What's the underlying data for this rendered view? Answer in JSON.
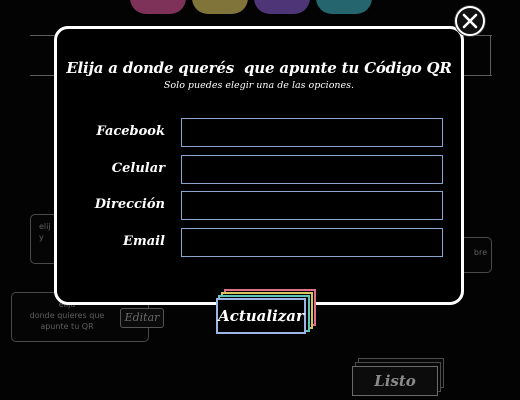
{
  "modal": {
    "title": "Elija a donde querés  que apunte tu Código QR",
    "subtitle": "Solo puedes elegir una de las opciones.",
    "fields": [
      {
        "label": "Facebook",
        "value": ""
      },
      {
        "label": "Celular",
        "value": ""
      },
      {
        "label": "Dirección",
        "value": ""
      },
      {
        "label": "Email",
        "value": ""
      }
    ],
    "submit_label": "Actualizar"
  },
  "close_icon": "close-icon",
  "background": {
    "card_qr_text": "elija\ndonde quieres que\napunte tu QR",
    "card_left_text": "elij\ny",
    "card_right_text": "bre",
    "edit_label": "Editar",
    "ready_label": "Listo"
  },
  "colors": {
    "modal_border": "#ffffff",
    "input_border": "#8aa4d0",
    "button_layers": [
      "#e0708a",
      "#d9c45a",
      "#5ec6b8",
      "#9fb4e6"
    ],
    "logo_colors": [
      "#e45aa0",
      "#e8d26a",
      "#8d5fd8",
      "#3fb7c7"
    ]
  }
}
